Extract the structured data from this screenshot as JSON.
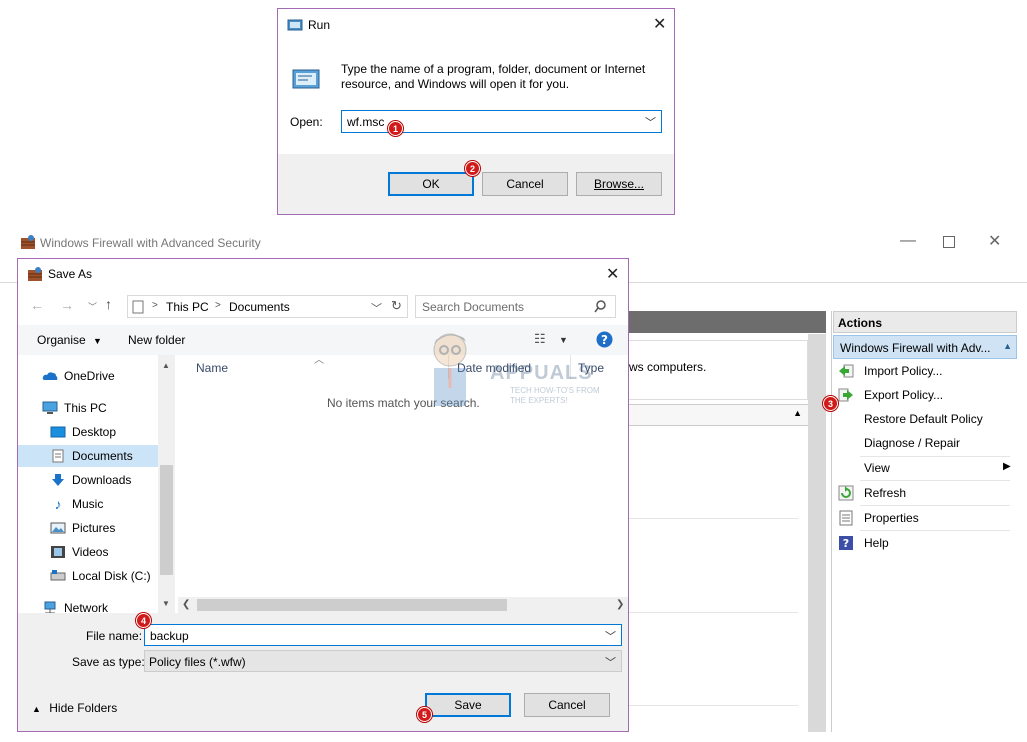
{
  "run": {
    "title": "Run",
    "description": "Type the name of a program, folder, document or Internet resource, and Windows will open it for you.",
    "open_label": "Open:",
    "open_value": "wf.msc",
    "ok_label": "OK",
    "cancel_label": "Cancel",
    "browse_label": "Browse..."
  },
  "firewall": {
    "title": "Windows Firewall with Advanced Security",
    "partial_text": "ws computers.",
    "actions_header": "Actions",
    "actions_group": "Windows Firewall with Adv...",
    "actions": [
      {
        "label": "Import Policy..."
      },
      {
        "label": "Export Policy..."
      },
      {
        "label": "Restore Default Policy"
      },
      {
        "label": "Diagnose / Repair"
      },
      {
        "label": "View"
      },
      {
        "label": "Refresh"
      },
      {
        "label": "Properties"
      },
      {
        "label": "Help"
      }
    ]
  },
  "saveas": {
    "title": "Save As",
    "breadcrumb": [
      "This PC",
      "Documents"
    ],
    "search_placeholder": "Search Documents",
    "organise_label": "Organise",
    "new_folder_label": "New folder",
    "columns": {
      "name": "Name",
      "date_modified": "Date modified",
      "type": "Type"
    },
    "empty_message": "No items match your search.",
    "nav": [
      {
        "label": "OneDrive"
      },
      {
        "label": "This PC"
      },
      {
        "label": "Desktop"
      },
      {
        "label": "Documents"
      },
      {
        "label": "Downloads"
      },
      {
        "label": "Music"
      },
      {
        "label": "Pictures"
      },
      {
        "label": "Videos"
      },
      {
        "label": "Local Disk (C:)"
      },
      {
        "label": "Network"
      }
    ],
    "file_name_label": "File name:",
    "file_name_value": "backup",
    "save_type_label": "Save as type:",
    "save_type_value": "Policy files (*.wfw)",
    "hide_folders_label": "Hide Folders",
    "save_label": "Save",
    "cancel_label": "Cancel"
  },
  "watermark": {
    "brand": "APPUALS",
    "tagline": "TECH HOW-TO'S FROM THE EXPERTS!"
  },
  "markers": [
    "1",
    "2",
    "3",
    "4",
    "5"
  ],
  "colors": {
    "accent": "#0078d7",
    "selection": "#cce4f7",
    "marker": "#d11a1a",
    "dialog_border": "#a36bb3",
    "header_gray": "#6d6d6d"
  }
}
